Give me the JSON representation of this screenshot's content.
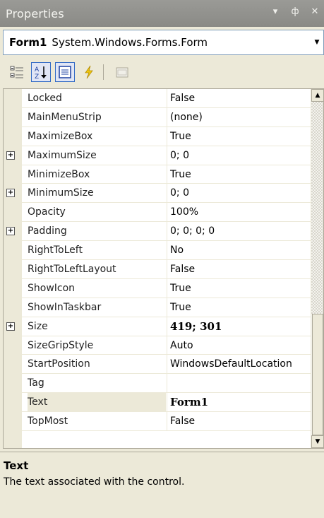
{
  "window": {
    "title": "Properties",
    "controls": [
      "▾",
      "ф",
      "✕"
    ]
  },
  "object_selector": {
    "name": "Form1",
    "type": "System.Windows.Forms.Form"
  },
  "toolbar": {
    "buttons": [
      "categorized-icon",
      "alphabetical-icon",
      "properties-icon",
      "events-icon",
      "property-pages-icon"
    ]
  },
  "properties": [
    {
      "name": "Locked",
      "value": "False",
      "expandable": false
    },
    {
      "name": "MainMenuStrip",
      "value": "(none)",
      "expandable": false
    },
    {
      "name": "MaximizeBox",
      "value": "True",
      "expandable": false
    },
    {
      "name": "MaximumSize",
      "value": "0; 0",
      "expandable": true
    },
    {
      "name": "MinimizeBox",
      "value": "True",
      "expandable": false
    },
    {
      "name": "MinimumSize",
      "value": "0; 0",
      "expandable": true
    },
    {
      "name": "Opacity",
      "value": "100%",
      "expandable": false
    },
    {
      "name": "Padding",
      "value": "0; 0; 0; 0",
      "expandable": true
    },
    {
      "name": "RightToLeft",
      "value": "No",
      "expandable": false
    },
    {
      "name": "RightToLeftLayout",
      "value": "False",
      "expandable": false
    },
    {
      "name": "ShowIcon",
      "value": "True",
      "expandable": false
    },
    {
      "name": "ShowInTaskbar",
      "value": "True",
      "expandable": false
    },
    {
      "name": "Size",
      "value": "419; 301",
      "expandable": true,
      "bold": true
    },
    {
      "name": "SizeGripStyle",
      "value": "Auto",
      "expandable": false
    },
    {
      "name": "StartPosition",
      "value": "WindowsDefaultLocation",
      "expandable": false
    },
    {
      "name": "Tag",
      "value": "",
      "expandable": false
    },
    {
      "name": "Text",
      "value": "Form1",
      "expandable": false,
      "bold": true,
      "selected": true
    },
    {
      "name": "TopMost",
      "value": "False",
      "expandable": false
    }
  ],
  "description": {
    "title": "Text",
    "text": "The text associated with the control."
  }
}
